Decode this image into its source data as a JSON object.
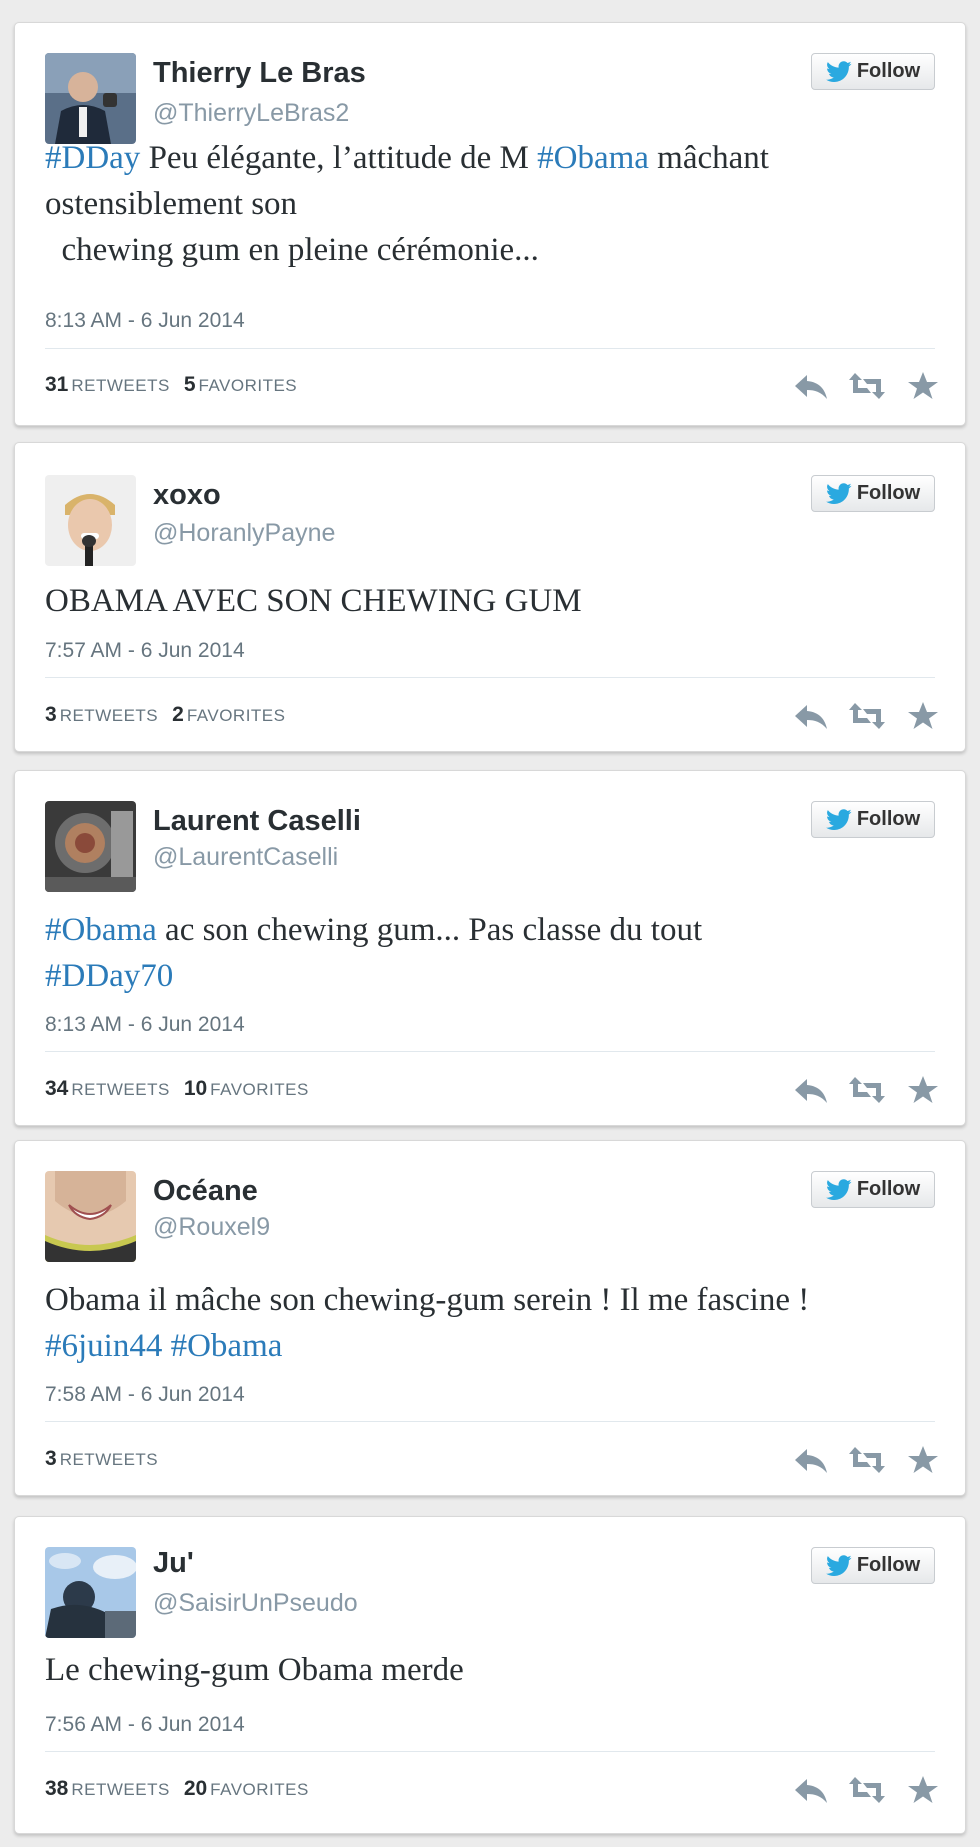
{
  "follow_label": "Follow",
  "colors": {
    "hashtag": "#2b7bb9",
    "name": "#292f33",
    "meta": "#66757f",
    "handle": "#8899a6"
  },
  "tweets": [
    {
      "name": "Thierry Le Bras",
      "handle": "@ThierryLeBras2",
      "lines": [
        [
          {
            "t": "#DDay",
            "tag": true
          },
          {
            "t": " Peu élégante, l’attitude de M "
          },
          {
            "t": "#Obama",
            "tag": true
          },
          {
            "t": " mâchant"
          }
        ],
        [
          {
            "t": "ostensiblement son"
          }
        ],
        [
          {
            "t": "  chewing gum en pleine cérémonie..."
          }
        ]
      ],
      "time": "8:13 AM - 6 Jun 2014",
      "retweets": "31",
      "retweets_label": "RETWEETS",
      "favorites": "5",
      "favorites_label": "FAVORITES"
    },
    {
      "name": "xoxo",
      "handle": "@HoranlyPayne",
      "lines": [
        [
          {
            "t": "OBAMA AVEC SON CHEWING GUM"
          }
        ]
      ],
      "time": "7:57 AM - 6 Jun 2014",
      "retweets": "3",
      "retweets_label": "RETWEETS",
      "favorites": "2",
      "favorites_label": "FAVORITES"
    },
    {
      "name": "Laurent Caselli",
      "handle": "@LaurentCaselli",
      "lines": [
        [
          {
            "t": "#Obama",
            "tag": true
          },
          {
            "t": " ac son chewing gum... Pas classe du tout"
          }
        ],
        [
          {
            "t": "#DDay70",
            "tag": true
          }
        ]
      ],
      "time": "8:13 AM - 6 Jun 2014",
      "retweets": "34",
      "retweets_label": "RETWEETS",
      "favorites": "10",
      "favorites_label": "FAVORITES"
    },
    {
      "name": "Océane",
      "handle": "@Rouxel9",
      "lines": [
        [
          {
            "t": "Obama il mâche son chewing-gum serein ! Il me fascine !"
          }
        ],
        [
          {
            "t": "#6juin44",
            "tag": true
          },
          {
            "t": " "
          },
          {
            "t": "#Obama",
            "tag": true
          }
        ]
      ],
      "time": "7:58 AM - 6 Jun 2014",
      "retweets": "3",
      "retweets_label": "RETWEETS"
    },
    {
      "name": "Ju'",
      "handle": "@SaisirUnPseudo",
      "lines": [
        [
          {
            "t": "Le chewing-gum Obama merde"
          }
        ]
      ],
      "time": "7:56 AM - 6 Jun 2014",
      "retweets": "38",
      "retweets_label": "RETWEETS",
      "favorites": "20",
      "favorites_label": "FAVORITES"
    }
  ]
}
